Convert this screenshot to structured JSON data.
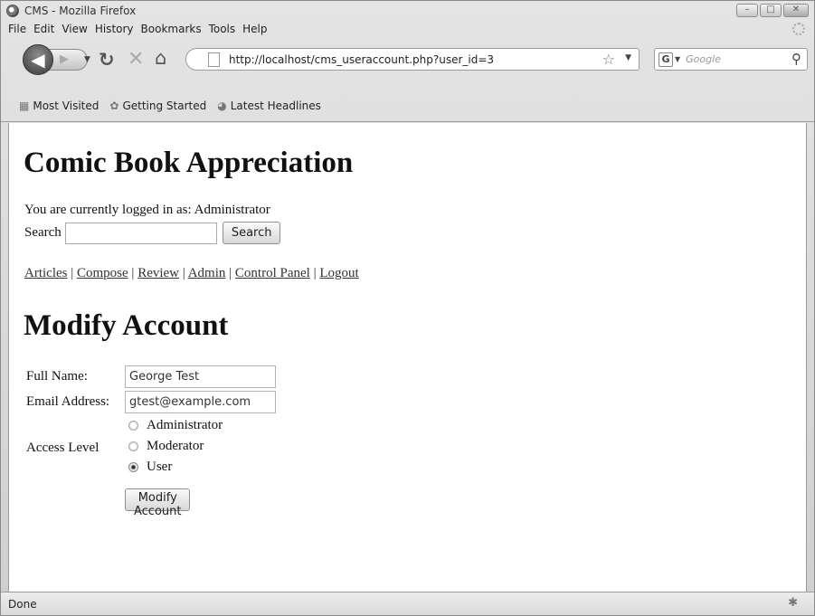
{
  "window": {
    "title": "CMS - Mozilla Firefox",
    "controls": {
      "minimize": "–",
      "maximize": "□",
      "close": "✕"
    }
  },
  "menu": [
    "File",
    "Edit",
    "View",
    "History",
    "Bookmarks",
    "Tools",
    "Help"
  ],
  "nav": {
    "url": "http://localhost/cms_useraccount.php?user_id=3",
    "search_placeholder": "Google",
    "search_engine_label": "G"
  },
  "bookmarks": [
    {
      "label": "Most Visited",
      "icon": "most-visited-icon"
    },
    {
      "label": "Getting Started",
      "icon": "firefox-icon"
    },
    {
      "label": "Latest Headlines",
      "icon": "rss-feed-icon"
    }
  ],
  "page": {
    "site_title": "Comic Book Appreciation",
    "login_status": "You are currently logged in as: Administrator",
    "search_label": "Search",
    "search_value": "",
    "search_button": "Search",
    "nav_links": [
      "Articles",
      "Compose",
      "Review",
      "Admin",
      "Control Panel",
      "Logout"
    ],
    "nav_separator": "|",
    "section_title": "Modify Account",
    "form": {
      "full_name_label": "Full Name:",
      "full_name_value": "George Test",
      "email_label": "Email Address:",
      "email_value": "gtest@example.com",
      "access_label": "Access Level",
      "access_options": [
        {
          "label": "Administrator",
          "checked": false
        },
        {
          "label": "Moderator",
          "checked": false
        },
        {
          "label": "User",
          "checked": true
        }
      ],
      "submit_label": "Modify Account"
    }
  },
  "status": {
    "text": "Done"
  }
}
